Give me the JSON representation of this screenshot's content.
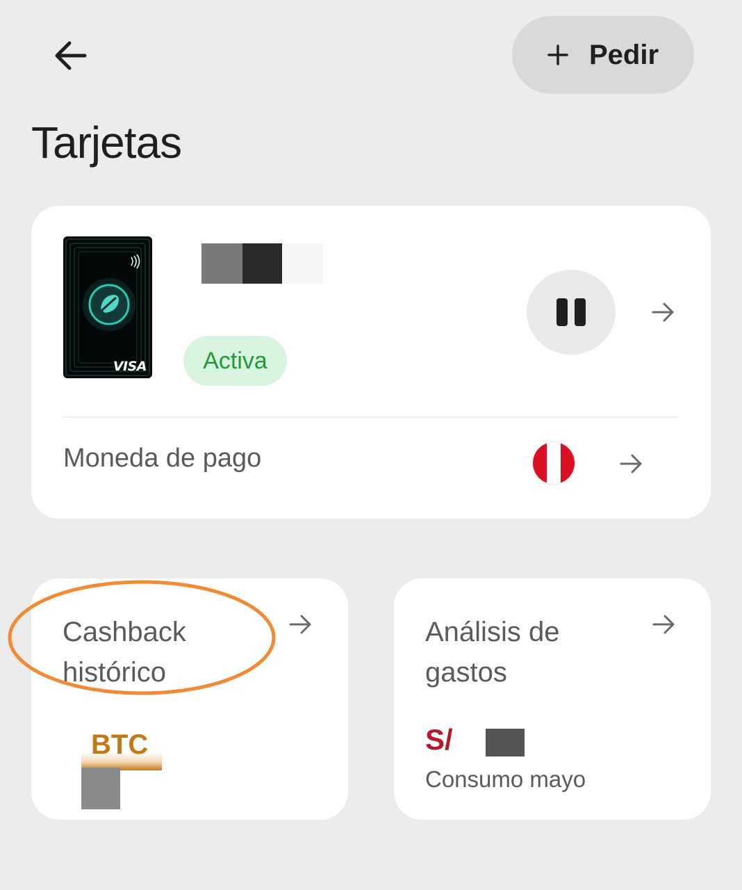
{
  "header": {
    "order_button_label": "Pedir",
    "title": "Tarjetas"
  },
  "card": {
    "brand": "VISA",
    "status": "Activa",
    "payment_currency_label": "Moneda de pago",
    "payment_currency_flag": "peru-flag"
  },
  "tiles": {
    "cashback": {
      "title_line1": "Cashback",
      "title_line2": "histórico",
      "currency": "BTC"
    },
    "spending": {
      "title_line1": "Análisis de",
      "title_line2": "gastos",
      "currency": "S/",
      "caption": "Consumo mayo"
    }
  },
  "colors": {
    "background": "#ececec",
    "status_green": "#1f9a3a",
    "status_bg": "#d8f3de",
    "highlight_orange": "#f28a34",
    "sol_red": "#b5192e",
    "btc_orange": "#c47a14"
  }
}
